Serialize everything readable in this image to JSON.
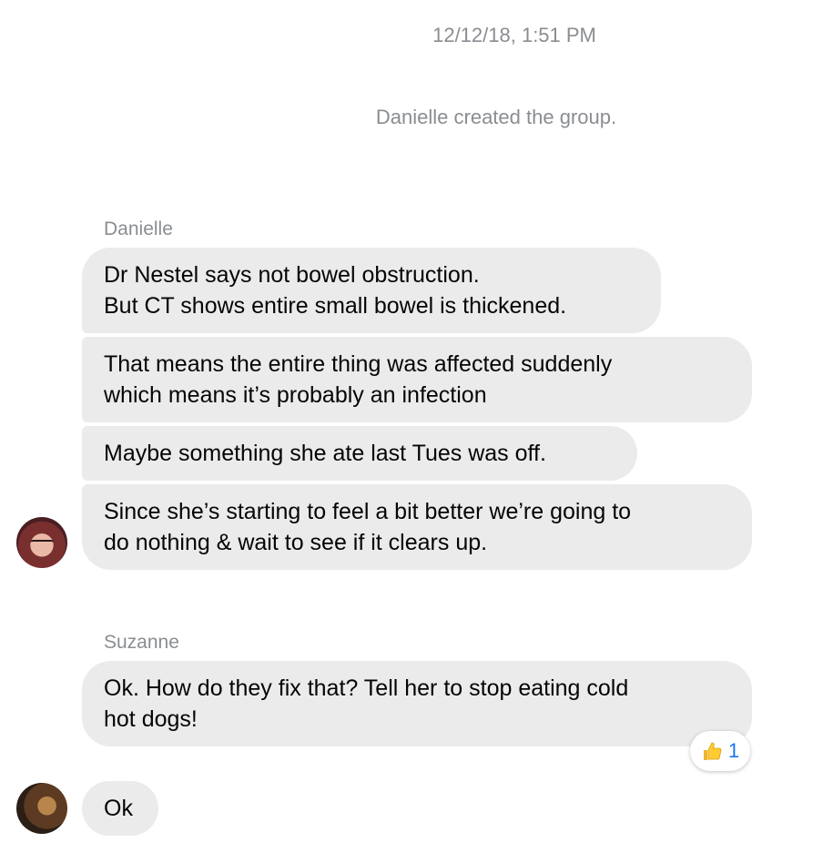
{
  "thread": {
    "timestamp": "12/12/18, 1:51 PM",
    "system_message": "Danielle created the group."
  },
  "groups": [
    {
      "sender": "Danielle",
      "messages": [
        {
          "lines": [
            "Dr Nestel says not bowel obstruction.",
            "But CT shows entire small bowel is thickened."
          ]
        },
        {
          "lines": [
            "That means the entire thing was affected suddenly",
            "which means it’s probably an infection"
          ]
        },
        {
          "lines": [
            "Maybe something she ate last Tues was off."
          ]
        },
        {
          "lines": [
            "Since she’s starting to feel a bit better we’re going to",
            "do nothing & wait to see if it clears up."
          ]
        }
      ]
    },
    {
      "sender": "Suzanne",
      "messages": [
        {
          "lines": [
            "Ok. How do they fix that? Tell her to stop eating cold",
            "hot dogs!"
          ],
          "reaction": {
            "icon": "thumbs-up-icon",
            "count": "1"
          }
        }
      ]
    },
    {
      "sender": "",
      "messages": [
        {
          "lines": [
            "Ok"
          ]
        }
      ]
    }
  ],
  "colors": {
    "bubble": "#ebebeb",
    "meta_text": "#8a8d91",
    "reaction_count": "#1877f2"
  }
}
